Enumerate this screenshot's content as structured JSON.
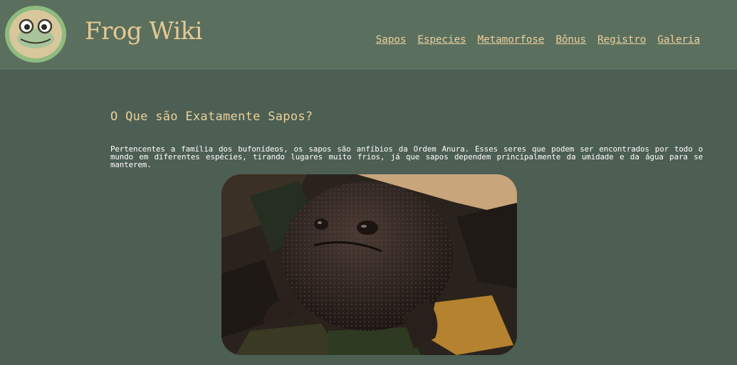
{
  "header": {
    "brand": "Frog Wiki",
    "logo_icon": "frog-face-icon",
    "nav": [
      {
        "label": "Sapos"
      },
      {
        "label": "Especies"
      },
      {
        "label": "Metamorfose"
      },
      {
        "label": "Bônus"
      },
      {
        "label": "Registro"
      },
      {
        "label": "Galeria"
      }
    ]
  },
  "main": {
    "title": "O Que são Exatamente Sapos?",
    "paragraph": "Pertencentes a família dos bufonídeos, os sapos são anfíbios da Ordem Anura. Esses seres que podem ser encontrados por todo o mundo em diferentes espécies, tirando lugares muito frios, já que sapos dependem principalmente da umidade e da água para se manterem.",
    "image_subject": "rain-frog-photo"
  },
  "colors": {
    "header_bg": "#5a6f5d",
    "page_bg": "#4d5e53",
    "accent_gold": "#e5c993",
    "text": "#ffffff"
  }
}
